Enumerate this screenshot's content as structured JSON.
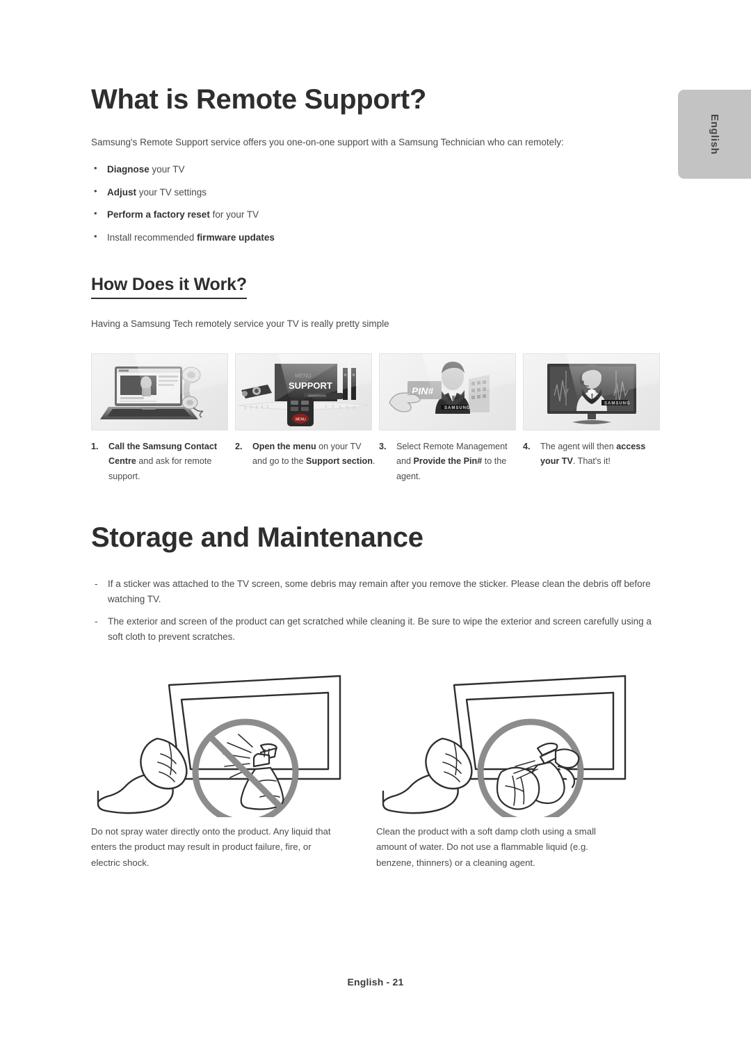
{
  "language_tab": {
    "label": "English"
  },
  "section_remote_support": {
    "title": "What is Remote Support?",
    "intro": "Samsung's Remote Support service offers you one-on-one support with a Samsung Technician who can remotely:",
    "bullets": [
      {
        "bold_first": "Diagnose",
        "rest": " your TV",
        "lead": ""
      },
      {
        "bold_first": "Adjust",
        "rest": " your TV settings",
        "lead": ""
      },
      {
        "bold_first": "Perform a factory reset",
        "rest": " for your TV",
        "lead": ""
      },
      {
        "lead": "Install recommended ",
        "bold_first": "firmware updates",
        "rest": ""
      }
    ]
  },
  "section_how_it_works": {
    "title": "How Does it Work?",
    "intro": "Having a Samsung Tech remotely service your TV is really pretty simple",
    "steps": [
      {
        "number": "1.",
        "bold_part": "Call the Samsung Contact Centre",
        "rest_part": " and ask for remote support.",
        "image_name": "laptop-with-phone-handset-thumbnail"
      },
      {
        "number": "2.",
        "bold_part": "Open the menu",
        "rest_part": " on your TV and go to the ",
        "bold_part_2": "Support section",
        "rest_part_2": ".",
        "image_name": "tv-menu-support-thumbnail"
      },
      {
        "number": "3.",
        "lead_part": "Select Remote Management and ",
        "bold_part": "Provide the Pin#",
        "rest_part": " to the agent.",
        "image_name": "pin-number-agent-thumbnail"
      },
      {
        "number": "4.",
        "lead_part": "The agent will then ",
        "bold_part": "access your TV",
        "rest_part": ". That's it!",
        "image_name": "tv-agent-access-thumbnail"
      }
    ],
    "thumbnail_labels": {
      "menu": "MENU",
      "support": "SUPPORT",
      "pin": "PIN#",
      "brand": "SAMSUNG",
      "menu_button": "MENU"
    }
  },
  "section_storage": {
    "title": "Storage and Maintenance",
    "notes": [
      "If a sticker was attached to the TV screen, some debris may remain after you remove the sticker. Please clean the debris off before watching TV.",
      "The exterior and screen of the product can get scratched while cleaning it. Be sure to wipe the exterior and screen carefully using a soft cloth to prevent scratches."
    ],
    "illustrations": [
      {
        "name": "do-not-spray-water-on-tv-illustration",
        "caption": "Do not spray water directly onto the product. Any liquid that enters the product may result in product failure, fire, or electric shock."
      },
      {
        "name": "spray-onto-cloth-illustration",
        "caption": "Clean the product with a soft damp cloth using a small amount of water. Do not use a flammable liquid (e.g. benzene, thinners) or a cleaning agent."
      }
    ]
  },
  "footer": {
    "page_label": "English - 21"
  }
}
